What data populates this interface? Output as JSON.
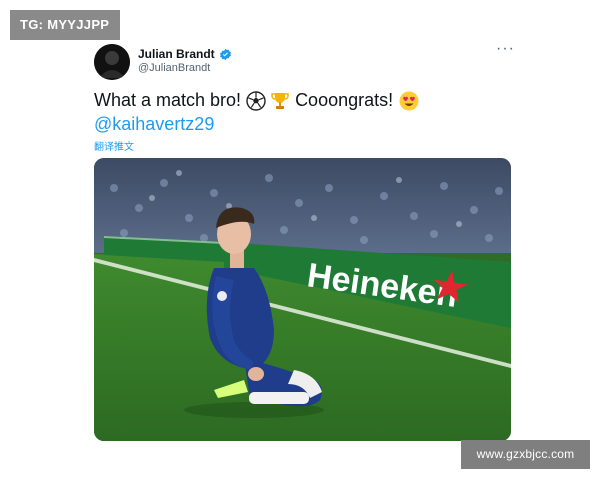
{
  "watermarks": {
    "top": "TG: MYYJJPP",
    "bottom": "www.gzxbjcc.com"
  },
  "tweet": {
    "author": {
      "display_name": "Julian Brandt",
      "handle": "@JulianBrandt",
      "verified": true
    },
    "more_icon": "more-horizontal-icon",
    "text": {
      "part1": "What a match bro!",
      "emoji1": "soccer-ball-emoji",
      "emoji2": "trophy-emoji",
      "part2": "Cooongrats!",
      "emoji3": "heart-eyes-emoji"
    },
    "mention": "@kaihavertz29",
    "translate_label": "翻译推文",
    "photo": {
      "sponsor_text": "Heineken"
    }
  },
  "colors": {
    "link": "#1d9bf0",
    "verified": "#1d9bf0",
    "secondary_text": "#536471",
    "jersey_blue": "#1f3d8a",
    "pitch_green": "#2f6d27",
    "board_green": "#1e7a35"
  }
}
